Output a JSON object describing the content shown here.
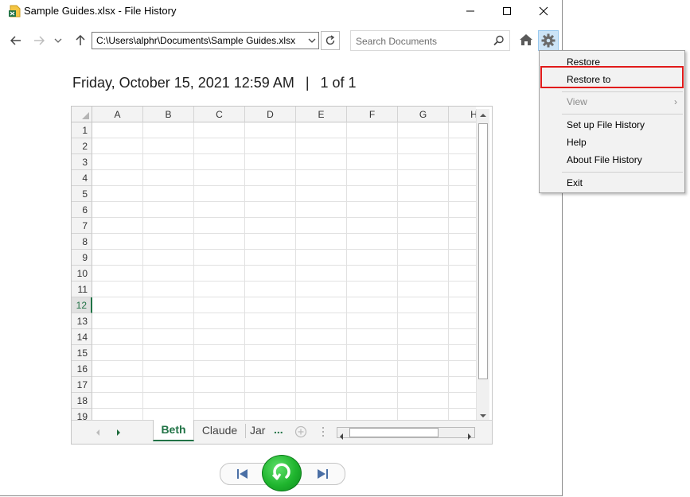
{
  "window": {
    "title": "Sample Guides.xlsx - File History"
  },
  "navigation": {
    "address": "C:\\Users\\alphr\\Documents\\Sample Guides.xlsx",
    "search_placeholder": "Search Documents"
  },
  "version_info": {
    "date": "Friday, October 15, 2021 12:59 AM",
    "separator": "|",
    "position": "1 of 1"
  },
  "spreadsheet": {
    "columns": [
      "A",
      "B",
      "C",
      "D",
      "E",
      "F",
      "G",
      "H"
    ],
    "rows": [
      "1",
      "2",
      "3",
      "4",
      "5",
      "6",
      "7",
      "8",
      "9",
      "10",
      "11",
      "12",
      "13",
      "14",
      "15",
      "16",
      "17",
      "18",
      "19"
    ],
    "selected_row": "12",
    "tabs": [
      "Beth",
      "Claude",
      "Jar"
    ],
    "active_tab": "Beth",
    "more_tabs": "..."
  },
  "menu": {
    "items": [
      {
        "label": "Restore",
        "enabled": true
      },
      {
        "label": "Restore to",
        "enabled": true,
        "highlighted": true
      },
      {
        "label": "View",
        "enabled": false,
        "submenu": true
      },
      {
        "label": "Set up File History",
        "enabled": true
      },
      {
        "label": "Help",
        "enabled": true
      },
      {
        "label": "About File History",
        "enabled": true
      },
      {
        "label": "Exit",
        "enabled": true
      }
    ]
  },
  "colors": {
    "excel_green": "#217346",
    "highlight_red": "#e11a1a",
    "restore_green": "#1fb52e",
    "gear_hover": "#cce4f7"
  },
  "icons": {
    "app": "excel-file-icon",
    "back": "arrow-left-icon",
    "forward": "arrow-right-icon",
    "recent": "chevron-down-icon",
    "up": "arrow-up-icon",
    "refresh": "refresh-icon",
    "search": "search-icon",
    "home": "home-icon",
    "settings": "gear-icon",
    "previous": "previous-version-icon",
    "restore": "restore-icon",
    "next": "next-version-icon"
  }
}
